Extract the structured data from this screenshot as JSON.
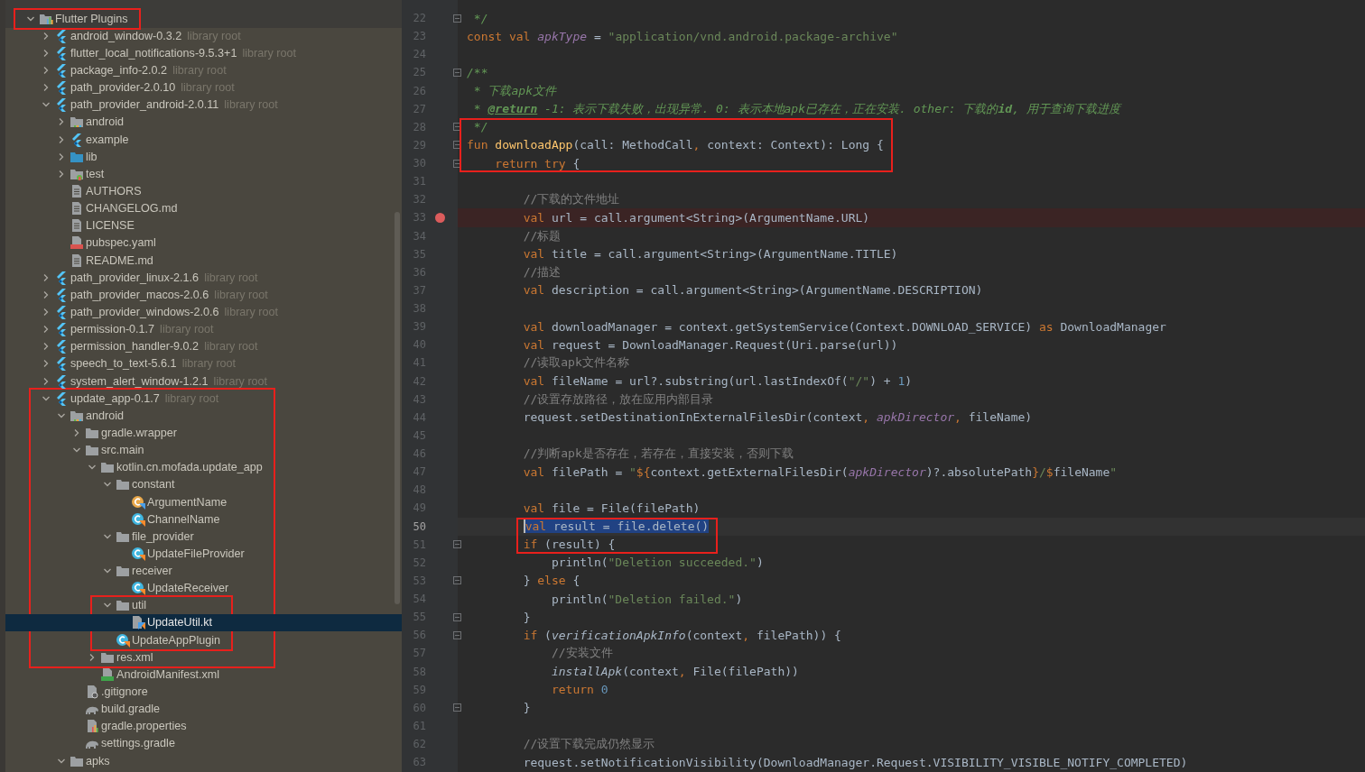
{
  "project_tree": {
    "items": [
      {
        "label": "Flutter Plugins",
        "kind": "library",
        "expanded": true,
        "selected": false,
        "frame_start": true,
        "frame_end": true,
        "children": [
          {
            "label": "android_window-0.3.2",
            "suffix": "library root",
            "kind": "flutter",
            "expanded": false,
            "selected": false
          },
          {
            "label": "flutter_local_notifications-9.5.3+1",
            "suffix": "library root",
            "kind": "flutter",
            "expanded": false,
            "selected": false
          },
          {
            "label": "package_info-2.0.2",
            "suffix": "library root",
            "kind": "flutter",
            "expanded": false,
            "selected": false
          },
          {
            "label": "path_provider-2.0.10",
            "suffix": "library root",
            "kind": "flutter",
            "expanded": false,
            "selected": false
          },
          {
            "label": "path_provider_android-2.0.11",
            "suffix": "library root",
            "kind": "flutter",
            "expanded": true,
            "selected": false,
            "children": [
              {
                "label": "android",
                "kind": "module-folder",
                "expanded": false,
                "selected": false
              },
              {
                "label": "example",
                "kind": "flutter",
                "expanded": false,
                "selected": false
              },
              {
                "label": "lib",
                "kind": "source-folder",
                "expanded": false,
                "selected": false
              },
              {
                "label": "test",
                "kind": "test-folder",
                "expanded": false,
                "selected": false
              },
              {
                "label": "AUTHORS",
                "kind": "text-file",
                "selected": false
              },
              {
                "label": "CHANGELOG.md",
                "kind": "text-file",
                "selected": false
              },
              {
                "label": "LICENSE",
                "kind": "text-file",
                "selected": false
              },
              {
                "label": "pubspec.yaml",
                "kind": "yaml-file",
                "selected": false
              },
              {
                "label": "README.md",
                "kind": "text-file",
                "selected": false
              }
            ]
          },
          {
            "label": "path_provider_linux-2.1.6",
            "suffix": "library root",
            "kind": "flutter",
            "expanded": false,
            "selected": false
          },
          {
            "label": "path_provider_macos-2.0.6",
            "suffix": "library root",
            "kind": "flutter",
            "expanded": false,
            "selected": false
          },
          {
            "label": "path_provider_windows-2.0.6",
            "suffix": "library root",
            "kind": "flutter",
            "expanded": false,
            "selected": false
          },
          {
            "label": "permission-0.1.7",
            "suffix": "library root",
            "kind": "flutter",
            "expanded": false,
            "selected": false
          },
          {
            "label": "permission_handler-9.0.2",
            "suffix": "library root",
            "kind": "flutter",
            "expanded": false,
            "selected": false
          },
          {
            "label": "speech_to_text-5.6.1",
            "suffix": "library root",
            "kind": "flutter",
            "expanded": false,
            "selected": false
          },
          {
            "label": "system_alert_window-1.2.1",
            "suffix": "library root",
            "kind": "flutter",
            "expanded": false,
            "selected": false
          },
          {
            "label": "update_app-0.1.7",
            "suffix": "library root",
            "kind": "flutter",
            "expanded": true,
            "selected": false,
            "frame_start": true,
            "children": [
              {
                "label": "android",
                "kind": "module-folder",
                "expanded": true,
                "selected": false,
                "children": [
                  {
                    "label": "gradle.wrapper",
                    "kind": "folder",
                    "expanded": false,
                    "selected": false
                  },
                  {
                    "label": "src.main",
                    "kind": "folder",
                    "expanded": true,
                    "selected": false,
                    "children": [
                      {
                        "label": "kotlin.cn.mofada.update_app",
                        "kind": "folder",
                        "expanded": true,
                        "selected": false,
                        "children": [
                          {
                            "label": "constant",
                            "kind": "folder",
                            "expanded": true,
                            "selected": false,
                            "children": [
                              {
                                "label": "ArgumentName",
                                "kind": "kotlin-enum",
                                "selected": false
                              },
                              {
                                "label": "ChannelName",
                                "kind": "kotlin-class",
                                "selected": false
                              }
                            ]
                          },
                          {
                            "label": "file_provider",
                            "kind": "folder",
                            "expanded": true,
                            "selected": false,
                            "children": [
                              {
                                "label": "UpdateFileProvider",
                                "kind": "kotlin-class",
                                "selected": false
                              }
                            ]
                          },
                          {
                            "label": "receiver",
                            "kind": "folder",
                            "expanded": true,
                            "selected": false,
                            "children": [
                              {
                                "label": "UpdateReceiver",
                                "kind": "kotlin-class",
                                "selected": false
                              }
                            ]
                          },
                          {
                            "label": "util",
                            "kind": "folder",
                            "expanded": true,
                            "selected": false,
                            "frame_start": true,
                            "children": [
                              {
                                "label": "UpdateUtil.kt",
                                "kind": "kotlin-file",
                                "selected": true
                              }
                            ]
                          },
                          {
                            "label": "UpdateAppPlugin",
                            "kind": "kotlin-class",
                            "selected": false,
                            "frame_end": true
                          }
                        ]
                      },
                      {
                        "label": "res.xml",
                        "kind": "folder",
                        "expanded": false,
                        "selected": false,
                        "frame_end": true
                      },
                      {
                        "label": "AndroidManifest.xml",
                        "kind": "manifest-file",
                        "selected": false
                      }
                    ]
                  },
                  {
                    "label": ".gitignore",
                    "kind": "gitignore-file",
                    "selected": false
                  },
                  {
                    "label": "build.gradle",
                    "kind": "gradle-file",
                    "selected": false
                  },
                  {
                    "label": "gradle.properties",
                    "kind": "properties-file",
                    "selected": false
                  },
                  {
                    "label": "settings.gradle",
                    "kind": "gradle-file",
                    "selected": false
                  }
                ]
              },
              {
                "label": "apks",
                "kind": "folder",
                "expanded": true,
                "selected": false
              }
            ]
          }
        ]
      }
    ]
  },
  "editor": {
    "lines": [
      {
        "number": "22",
        "fold": true,
        "tokens": [
          {
            "text": " */",
            "kind": "doc"
          }
        ]
      },
      {
        "number": "23",
        "tokens": [
          {
            "text": "const val ",
            "kind": "keyword"
          },
          {
            "text": "apkType",
            "kind": "property"
          },
          {
            "text": " = ",
            "kind": "plain"
          },
          {
            "text": "\"application/vnd.android.package-archive\"",
            "kind": "string"
          }
        ]
      },
      {
        "number": "24"
      },
      {
        "number": "25",
        "fold": true,
        "tokens": [
          {
            "text": "/**",
            "kind": "doc"
          }
        ]
      },
      {
        "number": "26",
        "tokens": [
          {
            "text": " * 下载apk文件",
            "kind": "doc"
          }
        ]
      },
      {
        "number": "27",
        "tokens": [
          {
            "text": " * ",
            "kind": "doc"
          },
          {
            "text": "@return",
            "kind": "doctag"
          },
          {
            "text": " -1: 表示下载失败，出现异常. 0: 表示本地apk已存在，正在安装. other: 下载的",
            "kind": "doc"
          },
          {
            "text": "id",
            "kind": "docbold"
          },
          {
            "text": ", 用于查询下载进度",
            "kind": "doc"
          }
        ]
      },
      {
        "number": "28",
        "fold": true,
        "frame_start": true,
        "tokens": [
          {
            "text": " */",
            "kind": "doc"
          }
        ]
      },
      {
        "number": "29",
        "fold": true,
        "tokens": [
          {
            "text": "fun ",
            "kind": "keyword"
          },
          {
            "text": "downloadApp",
            "kind": "function"
          },
          {
            "text": "(call: MethodCall",
            "kind": "plain"
          },
          {
            "text": ", ",
            "kind": "keyword"
          },
          {
            "text": "context: Context): Long {",
            "kind": "plain"
          }
        ]
      },
      {
        "number": "30",
        "fold": true,
        "frame_end": true,
        "tokens": [
          {
            "text": "    return try ",
            "kind": "keyword"
          },
          {
            "text": "{",
            "kind": "plain"
          }
        ]
      },
      {
        "number": "31"
      },
      {
        "number": "32",
        "tokens": [
          {
            "text": "        //下载的文件地址",
            "kind": "comment"
          }
        ]
      },
      {
        "number": "33",
        "breakpoint": true,
        "tokens": [
          {
            "text": "        val ",
            "kind": "keyword"
          },
          {
            "text": "url = call.argument<String>(ArgumentName.URL)",
            "kind": "plain"
          }
        ]
      },
      {
        "number": "34",
        "tokens": [
          {
            "text": "        //标题",
            "kind": "comment"
          }
        ]
      },
      {
        "number": "35",
        "tokens": [
          {
            "text": "        val ",
            "kind": "keyword"
          },
          {
            "text": "title = call.argument<String>(ArgumentName.TITLE)",
            "kind": "plain"
          }
        ]
      },
      {
        "number": "36",
        "tokens": [
          {
            "text": "        //描述",
            "kind": "comment"
          }
        ]
      },
      {
        "number": "37",
        "tokens": [
          {
            "text": "        val ",
            "kind": "keyword"
          },
          {
            "text": "description = call.argument<String>(ArgumentName.DESCRIPTION)",
            "kind": "plain"
          }
        ]
      },
      {
        "number": "38"
      },
      {
        "number": "39",
        "tokens": [
          {
            "text": "        val ",
            "kind": "keyword"
          },
          {
            "text": "downloadManager = context.getSystemService(Context.DOWNLOAD_SERVICE) ",
            "kind": "plain"
          },
          {
            "text": "as ",
            "kind": "keyword"
          },
          {
            "text": "DownloadManager",
            "kind": "plain"
          }
        ]
      },
      {
        "number": "40",
        "tokens": [
          {
            "text": "        val ",
            "kind": "keyword"
          },
          {
            "text": "request = DownloadManager.Request(Uri.parse(url))",
            "kind": "plain"
          }
        ]
      },
      {
        "number": "41",
        "tokens": [
          {
            "text": "        //读取apk文件名称",
            "kind": "comment"
          }
        ]
      },
      {
        "number": "42",
        "tokens": [
          {
            "text": "        val ",
            "kind": "keyword"
          },
          {
            "text": "fileName = url?.substring(url.lastIndexOf(",
            "kind": "plain"
          },
          {
            "text": "\"/\"",
            "kind": "string"
          },
          {
            "text": ") + ",
            "kind": "plain"
          },
          {
            "text": "1",
            "kind": "number"
          },
          {
            "text": ")",
            "kind": "plain"
          }
        ]
      },
      {
        "number": "43",
        "tokens": [
          {
            "text": "        //设置存放路径，放在应用内部目录",
            "kind": "comment"
          }
        ]
      },
      {
        "number": "44",
        "tokens": [
          {
            "text": "        request.setDestinationInExternalFilesDir(context",
            "kind": "plain"
          },
          {
            "text": ", ",
            "kind": "keyword"
          },
          {
            "text": "apkDirector",
            "kind": "property"
          },
          {
            "text": ", ",
            "kind": "keyword"
          },
          {
            "text": "fileName)",
            "kind": "plain"
          }
        ]
      },
      {
        "number": "45"
      },
      {
        "number": "46",
        "tokens": [
          {
            "text": "        //判断apk是否存在，若存在，直接安装，否则下载",
            "kind": "comment"
          }
        ]
      },
      {
        "number": "47",
        "tokens": [
          {
            "text": "        val ",
            "kind": "keyword"
          },
          {
            "text": "filePath = ",
            "kind": "plain"
          },
          {
            "text": "\"",
            "kind": "string"
          },
          {
            "text": "${",
            "kind": "keyword"
          },
          {
            "text": "context.getExternalFilesDir(",
            "kind": "plain"
          },
          {
            "text": "apkDirector",
            "kind": "property"
          },
          {
            "text": ")?.absolutePath",
            "kind": "plain"
          },
          {
            "text": "}",
            "kind": "keyword"
          },
          {
            "text": "/",
            "kind": "string"
          },
          {
            "text": "$",
            "kind": "keyword"
          },
          {
            "text": "fileName",
            "kind": "plain"
          },
          {
            "text": "\"",
            "kind": "string"
          }
        ]
      },
      {
        "number": "48"
      },
      {
        "number": "49",
        "tokens": [
          {
            "text": "        val ",
            "kind": "keyword"
          },
          {
            "text": "file = File(filePath)",
            "kind": "plain"
          }
        ]
      },
      {
        "number": "50",
        "current": true,
        "selection": true,
        "frame_start": true,
        "tokens": [
          {
            "text": "        val ",
            "kind": "keyword"
          },
          {
            "text": "result = file.delete()",
            "kind": "plain"
          }
        ]
      },
      {
        "number": "51",
        "fold": true,
        "frame_end": true,
        "tokens": [
          {
            "text": "        if ",
            "kind": "keyword"
          },
          {
            "text": "(result) {",
            "kind": "plain"
          }
        ]
      },
      {
        "number": "52",
        "tokens": [
          {
            "text": "            println(",
            "kind": "plain"
          },
          {
            "text": "\"Deletion succeeded.\"",
            "kind": "string"
          },
          {
            "text": ")",
            "kind": "plain"
          }
        ]
      },
      {
        "number": "53",
        "fold": true,
        "tokens": [
          {
            "text": "        } ",
            "kind": "plain"
          },
          {
            "text": "else ",
            "kind": "keyword"
          },
          {
            "text": "{",
            "kind": "plain"
          }
        ]
      },
      {
        "number": "54",
        "tokens": [
          {
            "text": "            println(",
            "kind": "plain"
          },
          {
            "text": "\"Deletion failed.\"",
            "kind": "string"
          },
          {
            "text": ")",
            "kind": "plain"
          }
        ]
      },
      {
        "number": "55",
        "fold": true,
        "tokens": [
          {
            "text": "        }",
            "kind": "plain"
          }
        ]
      },
      {
        "number": "56",
        "fold": true,
        "tokens": [
          {
            "text": "        if ",
            "kind": "keyword"
          },
          {
            "text": "(",
            "kind": "plain"
          },
          {
            "text": "verificationApkInfo",
            "kind": "call"
          },
          {
            "text": "(context",
            "kind": "plain"
          },
          {
            "text": ", ",
            "kind": "keyword"
          },
          {
            "text": "filePath)) {",
            "kind": "plain"
          }
        ]
      },
      {
        "number": "57",
        "tokens": [
          {
            "text": "            //安装文件",
            "kind": "comment"
          }
        ]
      },
      {
        "number": "58",
        "tokens": [
          {
            "text": "            installApk",
            "kind": "call"
          },
          {
            "text": "(context",
            "kind": "plain"
          },
          {
            "text": ", ",
            "kind": "keyword"
          },
          {
            "text": "File(filePath))",
            "kind": "plain"
          }
        ]
      },
      {
        "number": "59",
        "tokens": [
          {
            "text": "            return ",
            "kind": "keyword"
          },
          {
            "text": "0",
            "kind": "number"
          }
        ]
      },
      {
        "number": "60",
        "fold": true,
        "tokens": [
          {
            "text": "        }",
            "kind": "plain"
          }
        ]
      },
      {
        "number": "61"
      },
      {
        "number": "62",
        "tokens": [
          {
            "text": "        //设置下载完成仍然显示",
            "kind": "comment"
          }
        ]
      },
      {
        "number": "63",
        "tokens": [
          {
            "text": "        request.setNotificationVisibility(DownloadManager.Request.VISIBILITY_VISIBLE_NOTIFY_COMPLETED)",
            "kind": "plain"
          }
        ]
      }
    ]
  }
}
